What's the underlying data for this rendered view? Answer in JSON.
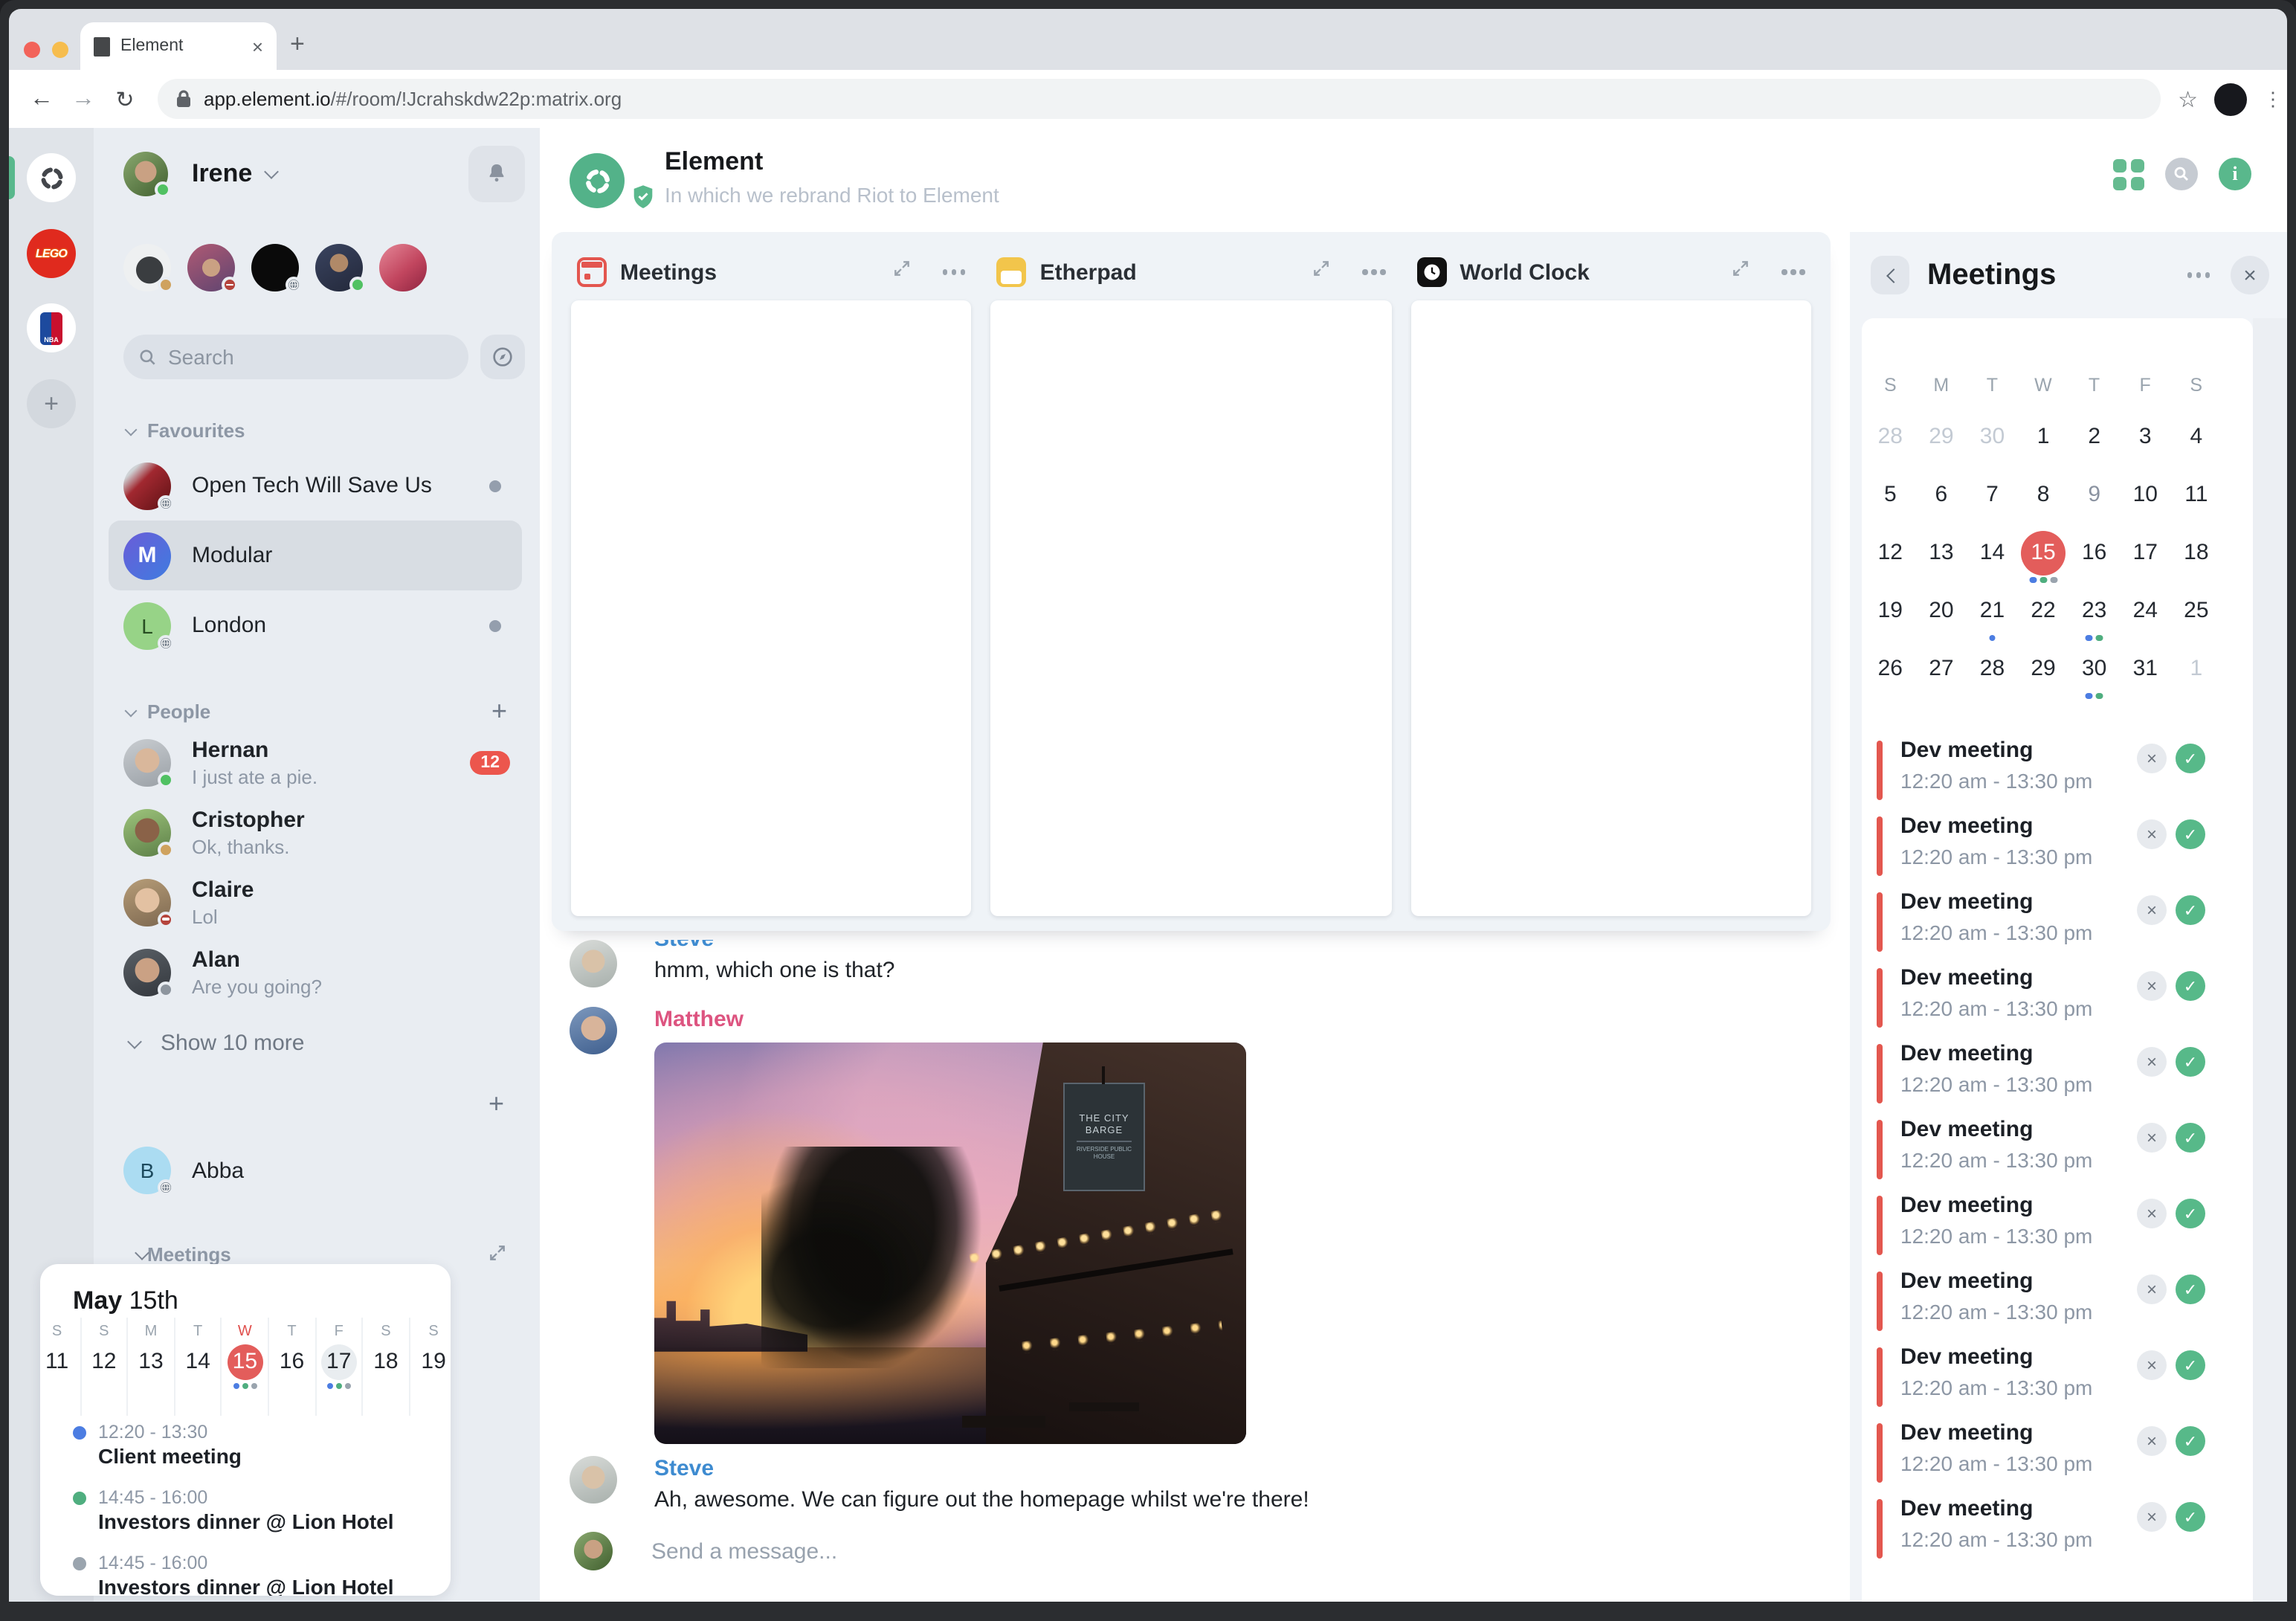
{
  "colors": {
    "accent_green": "#59b88c",
    "accent_red": "#e3574f",
    "username_blue": "#3e8bd0",
    "username_pink": "#dd5480",
    "dot": {
      "blue": "#4c7de2",
      "green": "#4fae7f",
      "gray": "#9aa4ae"
    }
  },
  "browser": {
    "tab_title": "Element",
    "tab_close": "×",
    "new_tab": "+",
    "back": "←",
    "forward": "→",
    "reload": "↻",
    "url_host": "app.element.io",
    "url_path": "/#/room/!Jcrahskdw22p:matrix.org",
    "star": "☆",
    "kebab": "⋮"
  },
  "rail": {
    "lego_label": "LEGO",
    "nba_label": "NBA",
    "add_label": "+"
  },
  "sidebar": {
    "user_name": "Irene",
    "search_placeholder": "Search",
    "favourites_label": "Favourites",
    "people_label": "People",
    "people_add": "+",
    "rooms_add": "+",
    "meetings_label": "Meetings",
    "favourites": [
      {
        "name": "Open Tech Will Save Us"
      },
      {
        "name": "Modular",
        "initial": "M"
      },
      {
        "name": "London",
        "initial": "L"
      }
    ],
    "people": [
      {
        "name": "Hernan",
        "preview": "I just ate a pie.",
        "badge": "12"
      },
      {
        "name": "Cristopher",
        "preview": "Ok, thanks."
      },
      {
        "name": "Claire",
        "preview": "Lol"
      },
      {
        "name": "Alan",
        "preview": "Are you going?"
      }
    ],
    "show_more": "Show 10 more",
    "abba_name": "Abba",
    "abba_initial": "B",
    "mini_calendar": {
      "month": "May",
      "day_ordinal": "15th",
      "strip": [
        {
          "dow": "S",
          "day": "11"
        },
        {
          "dow": "S",
          "day": "12"
        },
        {
          "dow": "M",
          "day": "13"
        },
        {
          "dow": "T",
          "day": "14"
        },
        {
          "dow": "W",
          "day": "15",
          "red_dow": true,
          "today": true,
          "dots": [
            "blue",
            "green",
            "gray"
          ]
        },
        {
          "dow": "T",
          "day": "16"
        },
        {
          "dow": "F",
          "day": "17",
          "focus": true,
          "dots": [
            "blue",
            "green",
            "gray"
          ]
        },
        {
          "dow": "S",
          "day": "18"
        },
        {
          "dow": "S",
          "day": "19"
        }
      ],
      "agenda": [
        {
          "color": "blue",
          "time": "12:20 - 13:30",
          "title": "Client meeting"
        },
        {
          "color": "green",
          "time": "14:45 - 16:00",
          "title": "Investors dinner @ Lion Hotel"
        },
        {
          "color": "gray",
          "time": "14:45 - 16:00",
          "title": "Investors dinner @ Lion Hotel"
        }
      ]
    }
  },
  "room_header": {
    "title": "Element",
    "topic": "In which we rebrand Riot to Element"
  },
  "widgets": {
    "items": [
      {
        "title": "Meetings"
      },
      {
        "title": "Etherpad"
      },
      {
        "title": "World Clock"
      }
    ]
  },
  "chat": {
    "msg1_sender": "Steve",
    "msg1_text": "hmm, which one is that?",
    "msg2_sender": "Matthew",
    "photo_sign_line1": "THE CITY BARGE",
    "photo_sign_line2": "RIVERSIDE PUBLIC HOUSE",
    "msg3_sender": "Steve",
    "msg3_text": "Ah, awesome. We can figure out the homepage whilst we're there!",
    "composer_placeholder": "Send a message..."
  },
  "right_panel": {
    "title": "Meetings",
    "close": "×",
    "weekdays": [
      "S",
      "M",
      "T",
      "W",
      "T",
      "F",
      "S"
    ],
    "calendar_cells": [
      {
        "d": "28",
        "muted": true
      },
      {
        "d": "29",
        "muted": true
      },
      {
        "d": "30",
        "muted": true
      },
      {
        "d": "1"
      },
      {
        "d": "2"
      },
      {
        "d": "3"
      },
      {
        "d": "4"
      },
      {
        "d": "5"
      },
      {
        "d": "6"
      },
      {
        "d": "7"
      },
      {
        "d": "8"
      },
      {
        "d": "9",
        "dim": true
      },
      {
        "d": "10"
      },
      {
        "d": "11"
      },
      {
        "d": "12"
      },
      {
        "d": "13"
      },
      {
        "d": "14"
      },
      {
        "d": "15",
        "today": true,
        "dots": [
          "blue",
          "green",
          "gray"
        ]
      },
      {
        "d": "16"
      },
      {
        "d": "17"
      },
      {
        "d": "18"
      },
      {
        "d": "19"
      },
      {
        "d": "20"
      },
      {
        "d": "21",
        "dots": [
          "blue"
        ]
      },
      {
        "d": "22"
      },
      {
        "d": "23",
        "dots": [
          "blue",
          "green"
        ]
      },
      {
        "d": "24"
      },
      {
        "d": "25"
      },
      {
        "d": "26"
      },
      {
        "d": "27"
      },
      {
        "d": "28"
      },
      {
        "d": "29"
      },
      {
        "d": "30",
        "dots": [
          "blue",
          "green"
        ]
      },
      {
        "d": "31"
      },
      {
        "d": "1",
        "muted": true
      }
    ],
    "meetings": [
      {
        "title": "Dev meeting",
        "time": "12:20 am - 13:30 pm"
      },
      {
        "title": "Dev meeting",
        "time": "12:20 am - 13:30 pm"
      },
      {
        "title": "Dev meeting",
        "time": "12:20 am - 13:30 pm"
      },
      {
        "title": "Dev meeting",
        "time": "12:20 am - 13:30 pm"
      },
      {
        "title": "Dev meeting",
        "time": "12:20 am - 13:30 pm"
      },
      {
        "title": "Dev meeting",
        "time": "12:20 am - 13:30 pm"
      },
      {
        "title": "Dev meeting",
        "time": "12:20 am - 13:30 pm"
      },
      {
        "title": "Dev meeting",
        "time": "12:20 am - 13:30 pm"
      },
      {
        "title": "Dev meeting",
        "time": "12:20 am - 13:30 pm"
      },
      {
        "title": "Dev meeting",
        "time": "12:20 am - 13:30 pm"
      },
      {
        "title": "Dev meeting",
        "time": "12:20 am - 13:30 pm"
      }
    ]
  }
}
